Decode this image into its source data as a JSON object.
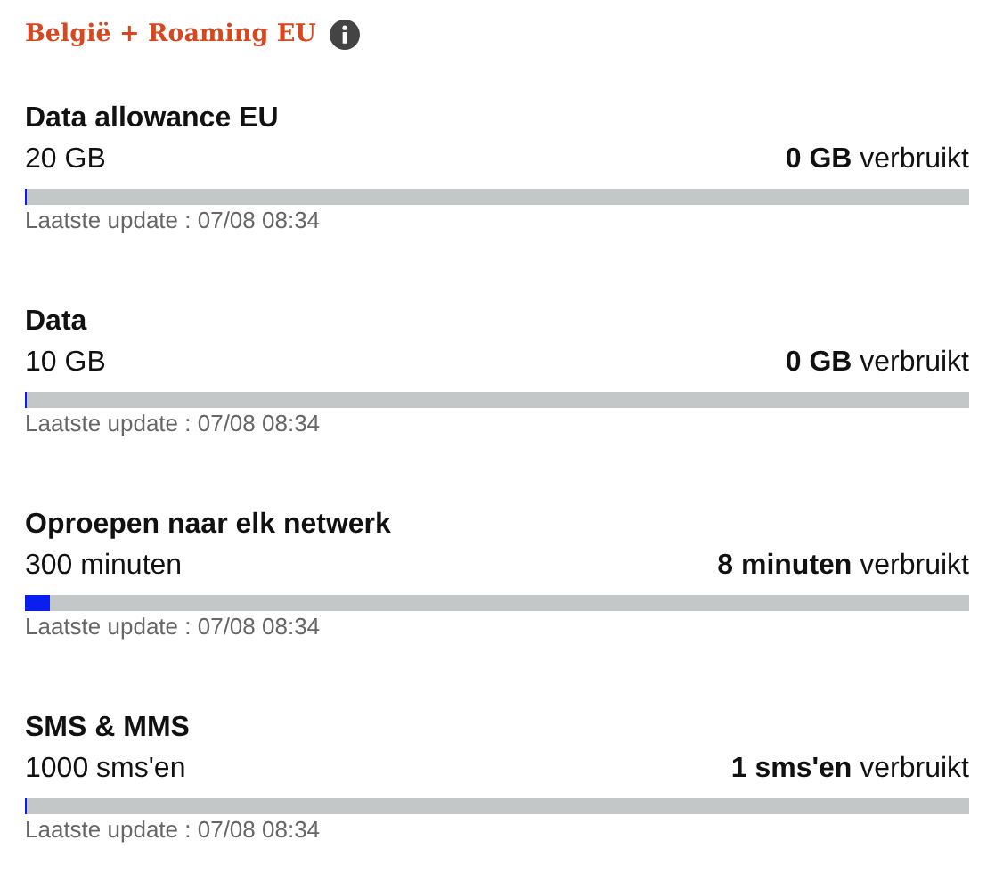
{
  "header": {
    "title": "België + Roaming EU"
  },
  "bundles": [
    {
      "name": "Data allowance EU",
      "allowance": "20 GB",
      "usage": "**0 GB** verbruikt",
      "level": 0,
      "updated": "Laatste update : 07/08 08:34"
    },
    {
      "name": "Data",
      "allowance": "10 GB",
      "usage": "**0 GB** verbruikt",
      "level": 0,
      "updated": "Laatste update : 07/08 08:34"
    },
    {
      "name": "Oproepen naar elk netwerk",
      "allowance": "300 minuten",
      "usage": "**8 minuten** verbruikt",
      "level": 0.027,
      "updated": "Laatste update : 07/08 08:34"
    },
    {
      "name": "SMS & MMS",
      "allowance": "1000 sms'en",
      "usage": "**1 sms'en** verbruikt",
      "level": 0,
      "updated": "Laatste update : 07/08 08:34"
    }
  ]
}
